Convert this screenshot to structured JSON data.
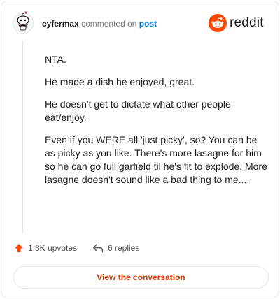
{
  "header": {
    "username": "cyfermax",
    "action_text": "commented on",
    "link_text": "post",
    "brand_word": "reddit"
  },
  "comment": {
    "paragraphs": [
      "NTA.",
      "He made a dish he enjoyed, great.",
      "He doesn't get to dictate what other people eat/enjoy.",
      "Even if you WERE all 'just picky', so? You can be as picky as you like. There's more lasagne for him so he can go full garfield til he's fit to explode. More lasagne doesn't sound like a bad thing to me...."
    ]
  },
  "actions": {
    "upvotes_label": "1.3K upvotes",
    "replies_label": "6 replies"
  },
  "cta": {
    "label": "View the conversation"
  },
  "colors": {
    "brand_orange": "#ff4500",
    "cta_text": "#d93a00",
    "link_blue": "#0079d3"
  }
}
